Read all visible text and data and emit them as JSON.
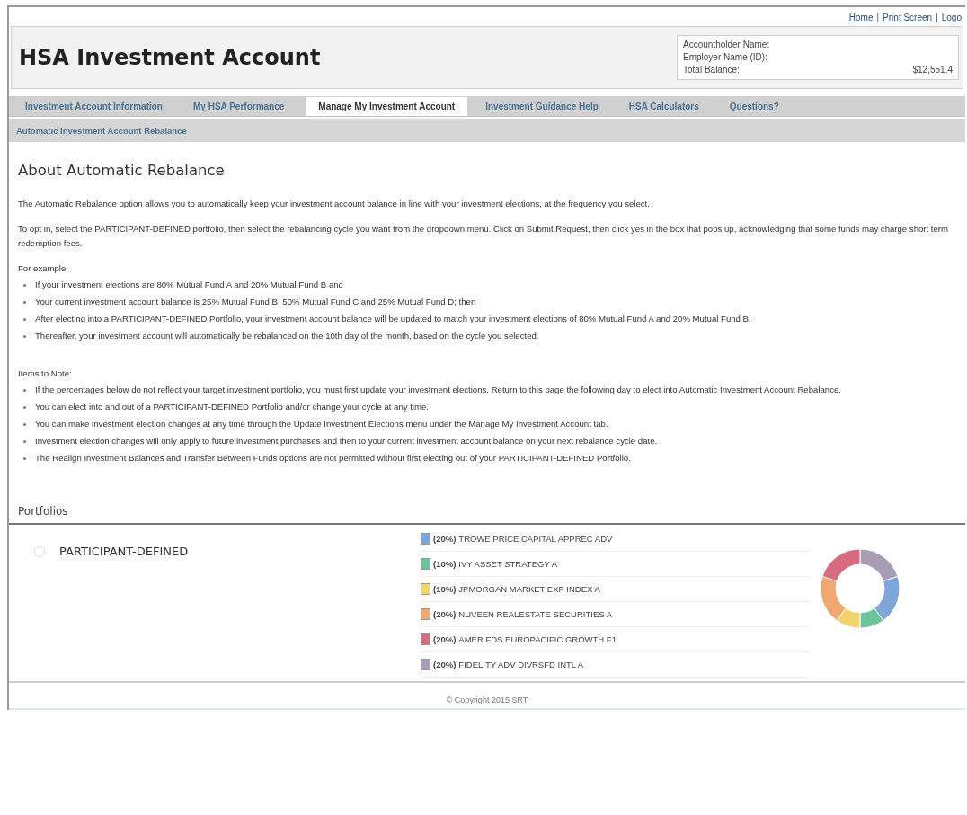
{
  "top_links": [
    {
      "kind": "link",
      "text": "Home"
    },
    {
      "kind": "separator",
      "text": "|"
    },
    {
      "kind": "link",
      "text": "Print Screen"
    },
    {
      "kind": "separator",
      "text": "|"
    },
    {
      "kind": "link",
      "text": "Logo"
    }
  ],
  "header": {
    "title": "HSA Investment Account",
    "info": [
      {
        "label": "Accountholder Name:"
      },
      {
        "label": "Employer Name (ID):"
      },
      {
        "label": "Total Balance:",
        "value": "$12,551.4"
      }
    ]
  },
  "tabs": [
    {
      "label": "Investment Account Information",
      "selected": false
    },
    {
      "label": "My HSA Performance",
      "selected": false
    },
    {
      "label": "Manage My Investment Account",
      "selected": true
    },
    {
      "label": "Investment Guidance Help",
      "selected": false
    },
    {
      "label": "HSA Calculators",
      "selected": false
    },
    {
      "label": "Questions?",
      "selected": false
    }
  ],
  "subnav": [
    "Automatic Investment Account Rebalance"
  ],
  "content": {
    "heading": "About Automatic Rebalance",
    "intro": [
      "The Automatic Rebalance option allows you to automatically keep your investment account balance in line with your investment elections, at the frequency you select.",
      "To opt in, select the PARTICIPANT-DEFINED portfolio, then select the rebalancing cycle you want from the dropdown menu. Click on Submit Request, then click yes in the box that pops up, acknowledging that some funds may charge short term redemption fees."
    ],
    "sections": [
      {
        "title": "For example:",
        "items": [
          "If your investment elections are 80% Mutual Fund A and 20% Mutual Fund B and",
          "Your current investment account balance is 25% Mutual Fund B, 50% Mutual Fund C and 25% Mutual Fund D; then",
          "After electing into a PARTICIPANT-DEFINED Portfolio, your investment account balance will be updated to match your investment elections of 80% Mutual Fund A and 20% Mutual Fund B.",
          "Thereafter, your investment account will automatically be rebalanced on the 10th day of the month, based on the cycle you selected."
        ]
      },
      {
        "title": "Items to Note:",
        "items": [
          "If the percentages below do not reflect your target investment portfolio, you must first update your investment elections. Return to this page the following day to elect into Automatic Investment Account Rebalance.",
          "You can elect into and out of a PARTICIPANT-DEFINED Portfolio and/or change your cycle at any time.",
          "You can make investment election changes at any time through the Update Investment Elections menu under the Manage My Investment Account tab.",
          "Investment election changes will only apply to future investment purchases and then to your current investment account balance on your next rebalance cycle date.",
          "The Realign Investment Balances and Transfer Between Funds options are not permitted without first electing out of your PARTICIPANT-DEFINED Portfolio."
        ]
      }
    ]
  },
  "portfolios": {
    "title": "Portfolios",
    "items": [
      {
        "name": "PARTICIPANT-DEFINED",
        "selected": false,
        "funds": [
          {
            "percent": "(20%)",
            "name": "TROWE PRICE CAPITAL APPREC ADV",
            "color": "#7fa6d8"
          },
          {
            "percent": "(10%)",
            "name": "IVY ASSET STRATEGY A",
            "color": "#6cc49a"
          },
          {
            "percent": "(10%)",
            "name": "JPMORGAN MARKET EXP INDEX A",
            "color": "#f3d36b"
          },
          {
            "percent": "(20%)",
            "name": "NUVEEN REALESTATE SECURITIES A",
            "color": "#f1a772"
          },
          {
            "percent": "(20%)",
            "name": "AMER FDS EUROPACIFIC GROWTH F1",
            "color": "#d96b80"
          },
          {
            "percent": "(20%)",
            "name": "FIDELITY ADV DIVRSFD INTL A",
            "color": "#a89cb4"
          }
        ],
        "chart_data": {
          "type": "donut",
          "values": [
            20,
            10,
            10,
            20,
            20,
            20
          ]
        }
      }
    ]
  },
  "footer": "© Copyright 2015 SRT"
}
